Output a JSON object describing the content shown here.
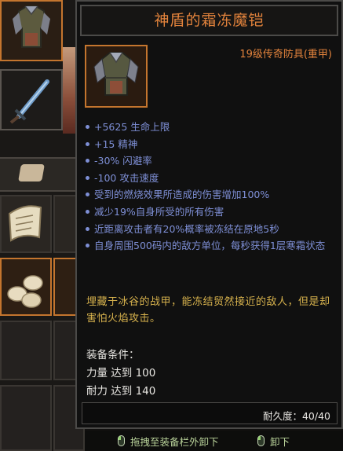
{
  "tooltip": {
    "title": "神盾的霜冻魔铠",
    "subtitle": "19级传奇防具(重甲)",
    "stats": [
      "+5625 生命上限",
      "+15 精神",
      "-30% 闪避率",
      "-100 攻击速度",
      "受到的燃烧效果所造成的伤害增加100%",
      "减少19%自身所受的所有伤害",
      "近距离攻击者有20%概率被冻结在原地5秒",
      "自身周围500码内的敌方单位，每秒获得1层寒霜状态"
    ],
    "flavor": "埋藏于冰谷的战甲，能冻结贸然接近的敌人，但是却害怕火焰攻击。",
    "requirements_title": "装备条件：",
    "requirements": [
      "力量 达到 100",
      "耐力 达到 140"
    ],
    "durability": "耐久度：40/40"
  },
  "hints": {
    "drag_unequip": "拖拽至装备栏外卸下",
    "unequip": "卸下"
  },
  "icons": {
    "item": "frost-armor-icon",
    "mouse_left": "mouse-left-icon",
    "mouse_right": "mouse-right-icon",
    "sword": "sword-icon",
    "scroll": "scroll-icon",
    "eggs": "eggs-icon",
    "tab": "bag-tab-icon"
  },
  "colors": {
    "title": "#e3833c",
    "stat": "#7e8fd6",
    "flavor": "#d7b24d",
    "hint": "#b9d29a",
    "selected_border": "#c4752e"
  }
}
